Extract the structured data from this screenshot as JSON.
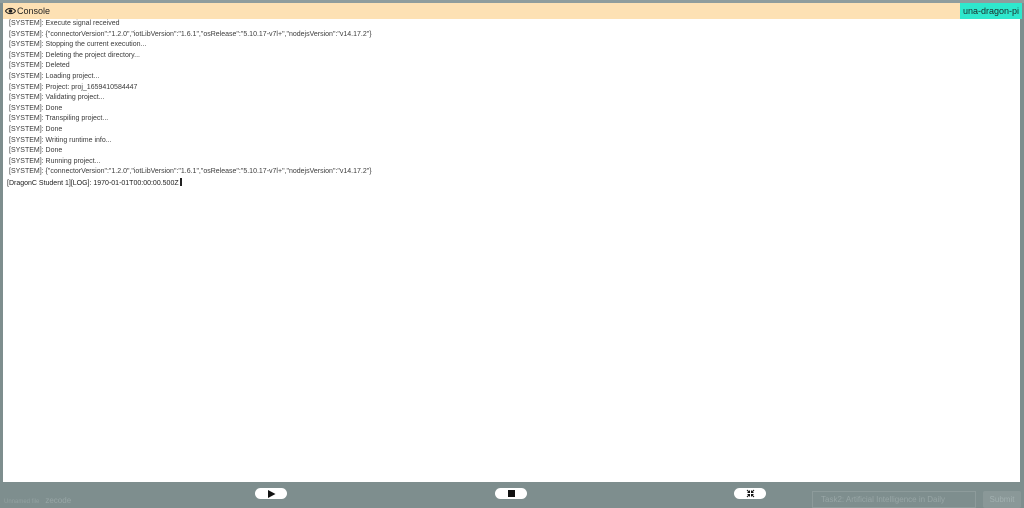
{
  "console": {
    "title": "Console",
    "device": "una-dragon-pi",
    "lines": [
      "[SYSTEM]: Execute signal received",
      "[SYSTEM]: {\"connectorVersion\":\"1.2.0\",\"iotLibVersion\":\"1.6.1\",\"osRelease\":\"5.10.17-v7l+\",\"nodejsVersion\":\"v14.17.2\"}",
      "[SYSTEM]: Stopping the current execution...",
      "[SYSTEM]: Deleting the project directory...",
      "[SYSTEM]: Deleted",
      "[SYSTEM]: Loading project...",
      "[SYSTEM]: Project: proj_1659410584447",
      "[SYSTEM]: Validating project...",
      "[SYSTEM]: Done",
      "[SYSTEM]: Transpiling project...",
      "[SYSTEM]: Done",
      "[SYSTEM]: Writing runtime info...",
      "[SYSTEM]: Done",
      "[SYSTEM]: Running project...",
      "[SYSTEM]: {\"connectorVersion\":\"1.2.0\",\"iotLibVersion\":\"1.6.1\",\"osRelease\":\"5.10.17-v7l+\",\"nodejsVersion\":\"v14.17.2\"}"
    ],
    "user_line": "[DragonC Student 1][LOG]: 1970-01-01T00:00:00.500Z"
  },
  "controls": {
    "play_icon": "play-icon",
    "stop_icon": "stop-icon",
    "collapse_icon": "collapse-arrows-icon"
  },
  "background": {
    "left_label": "Unnamed file",
    "project_name": "zecode",
    "task_select": "Task2: Artificial Intelligence in Daily",
    "submit_label": "Submit"
  },
  "colors": {
    "header_bg": "#fde1b4",
    "device_badge_bg": "#2ee8cd",
    "backdrop": "#7e8e8e"
  }
}
